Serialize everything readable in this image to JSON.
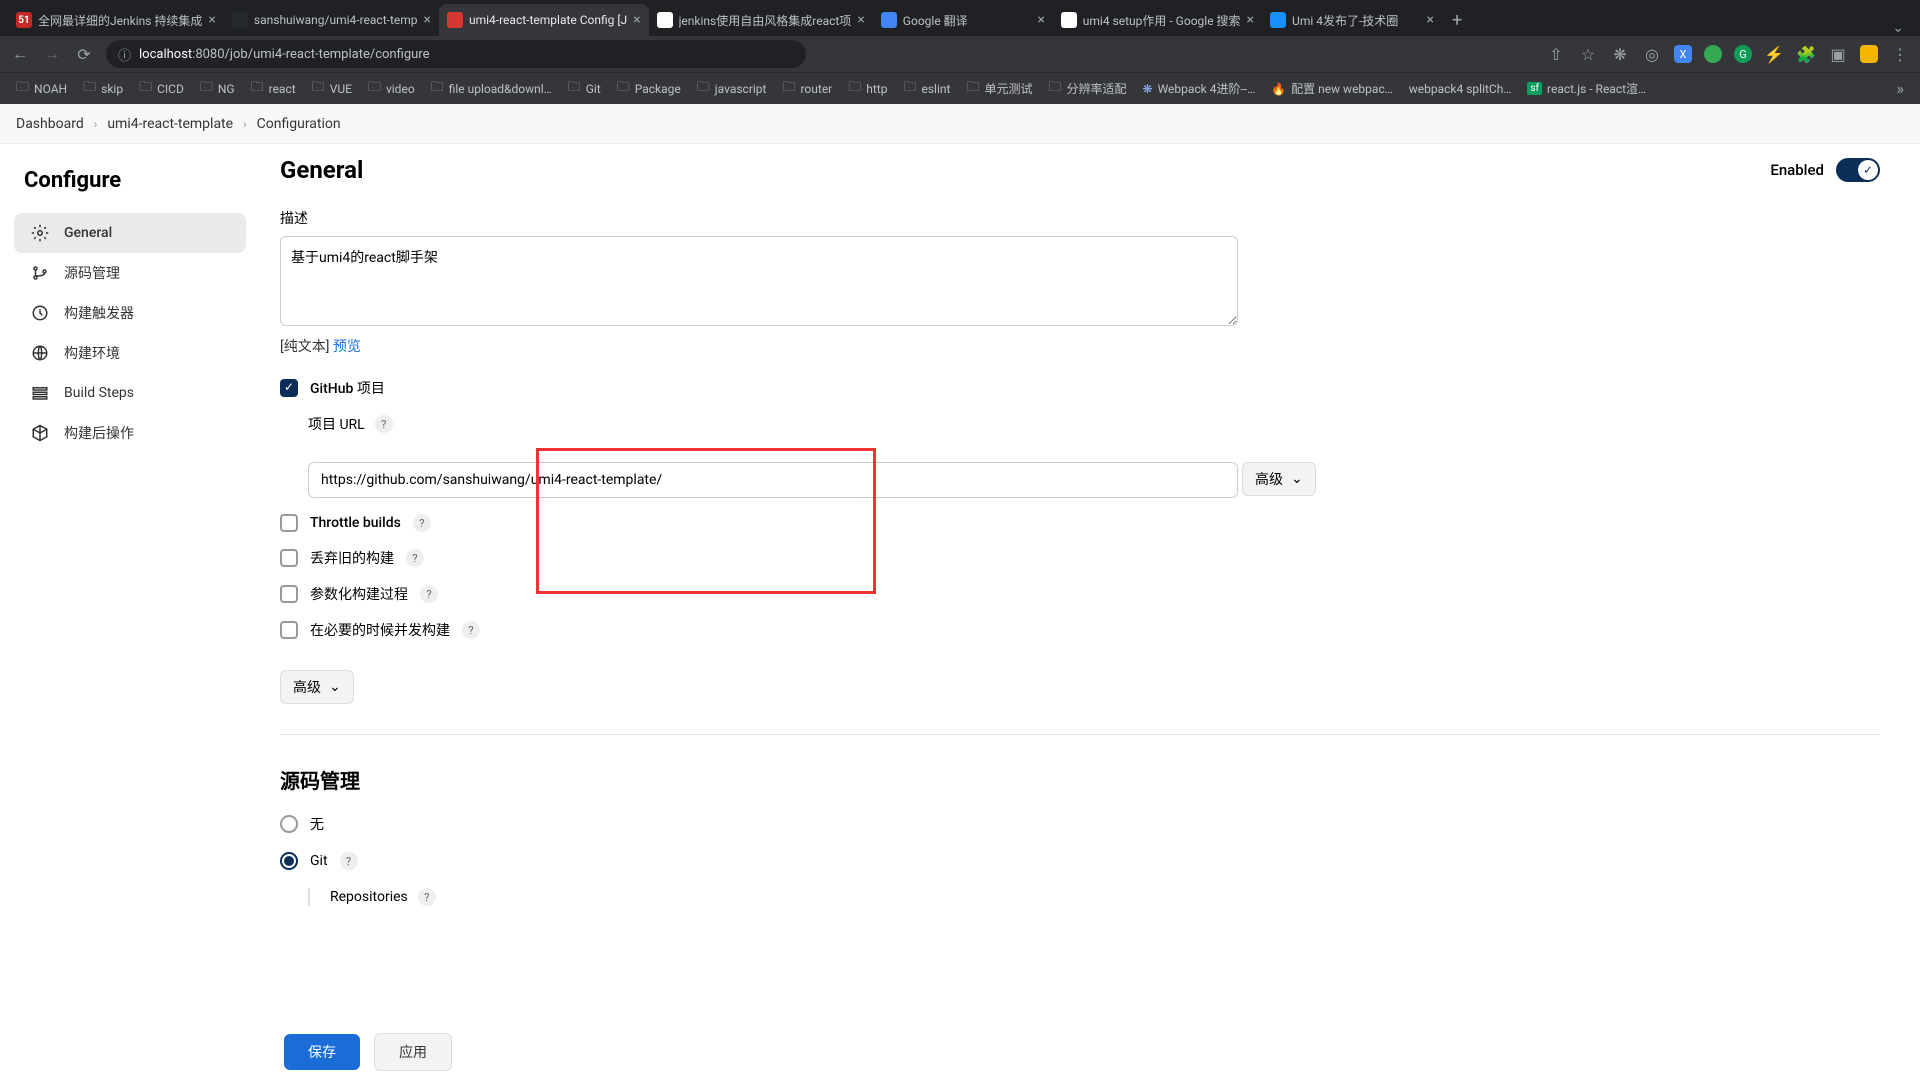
{
  "browser": {
    "tabs": [
      {
        "title": "全网最详细的Jenkins 持续集成",
        "fav_bg": "#c62828",
        "fav_txt": "51"
      },
      {
        "title": "sanshuiwang/umi4-react-temp",
        "fav_bg": "#24292e",
        "fav_txt": ""
      },
      {
        "title": "umi4-react-template Config [J",
        "fav_bg": "#d33833",
        "fav_txt": "",
        "active": true
      },
      {
        "title": "jenkins使用自由风格集成react项",
        "fav_bg": "#fff",
        "fav_txt": "G"
      },
      {
        "title": "Google 翻译",
        "fav_bg": "#4285f4",
        "fav_txt": ""
      },
      {
        "title": "umi4 setup作用 - Google 搜索",
        "fav_bg": "#fff",
        "fav_txt": "G"
      },
      {
        "title": "Umi 4发布了-技术圈",
        "fav_bg": "#1890ff",
        "fav_txt": ""
      }
    ],
    "url_host": "localhost",
    "url_port": ":8080",
    "url_path": "/job/umi4-react-template/configure"
  },
  "bookmarks": [
    "NOAH",
    "skip",
    "CICD",
    "NG",
    "react",
    "VUE",
    "video",
    "file upload&downl…",
    "Git",
    "Package",
    "javascript",
    "router",
    "http",
    "eslint",
    "单元测试",
    "分辨率适配"
  ],
  "bookmarks_special": [
    {
      "label": "Webpack 4进阶--…",
      "icon": "❋",
      "color": "#8ab4f8"
    },
    {
      "label": "配置 new webpac…",
      "icon": "🔥",
      "color": "#f28b82"
    },
    {
      "label": "webpack4 splitCh…",
      "icon": "",
      "color": ""
    },
    {
      "label": "react.js - React渲…",
      "icon": "sf",
      "color": "#0a9e5e"
    }
  ],
  "breadcrumbs": [
    "Dashboard",
    "umi4-react-template",
    "Configuration"
  ],
  "sidebar": {
    "title": "Configure",
    "items": [
      "General",
      "源码管理",
      "构建触发器",
      "构建环境",
      "Build Steps",
      "构建后操作"
    ]
  },
  "general": {
    "heading": "General",
    "enabled_label": "Enabled",
    "desc_label": "描述",
    "desc_value": "基于umi4的react脚手架",
    "hint_prefix": "[纯文本] ",
    "hint_link": "预览",
    "github_label": "GitHub 项目",
    "project_url_label": "项目 URL",
    "project_url_value": "https://github.com/sanshuiwang/umi4-react-template/",
    "advanced_label": "高级",
    "checkboxes": [
      "Throttle builds",
      "丢弃旧的构建",
      "参数化构建过程",
      "在必要的时候并发构建"
    ]
  },
  "scm": {
    "heading": "源码管理",
    "none": "无",
    "git": "Git",
    "repositories": "Repositories"
  },
  "buttons": {
    "save": "保存",
    "apply": "应用"
  }
}
